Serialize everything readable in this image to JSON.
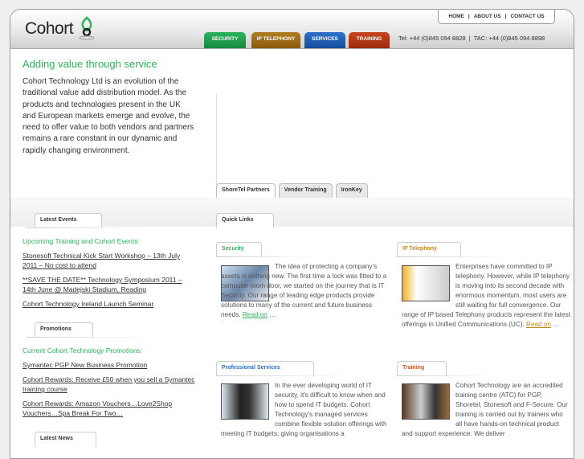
{
  "header": {
    "logo": "Cohort",
    "topnav": [
      "HOME",
      "ABOUT US",
      "CONTACT US"
    ],
    "tabs": [
      {
        "label": "SECURITY",
        "color": "#1e9b4c"
      },
      {
        "label": "IP TELEPHONY",
        "color": "#9b6a12"
      },
      {
        "label": "SERVICES",
        "color": "#1a5cb3"
      },
      {
        "label": "TRAINING",
        "color": "#b0341a"
      }
    ],
    "phone": "Tel: +44 (0)845 094 8828  |  TAC: +44 (0)845 094 8898"
  },
  "intro": {
    "heading": "Adding value through service",
    "body": "Cohort Technology Ltd is an evolution of the traditional value add distribution model. As the products and technologies present in the UK and European markets emerge and evolve, the need to offer value to both vendors and partners remains a rare constant in our dynamic and rapidly changing environment."
  },
  "feature_tabs": [
    "ShoreTel Partners",
    "Vendor Training",
    "IronKey"
  ],
  "events": {
    "tab": "Latest Events",
    "subheading": "Upcoming Training and Cohort Events:",
    "links": [
      "Stonesoft Technical Kick Start Workshop – 13th July 2011 – No cost to attend",
      "**SAVE THE DATE** Technology Symposium 2011 – 14th June @ Madejski Stadium, Reading",
      "Cohort Technology Ireland Launch Seminar"
    ]
  },
  "promotions": {
    "tab": "Promotions",
    "subheading": "Current Cohort Technology Promotions:",
    "links": [
      "Symantec PGP New Business Promotion",
      "Cohort Rewards: Receive £50 when you sell a Symantec training course",
      "Cohort Rewards: Amazon Vouchers…Love2Shop Vouchers…Spa Break For Two…"
    ]
  },
  "news": {
    "tab": "Latest News"
  },
  "quick_links": {
    "tab": "Quick Links",
    "items": [
      {
        "title": "Security",
        "color": "#2db45a",
        "text": "The idea of protecting a company's assets is nothing new. The first time a lock was fitted to a computer room door, we started on the journey that is IT Security. Our range of leading edge products provide solutions to many of the current and future business needs.",
        "read": "Read on",
        "ellipsis": " …"
      },
      {
        "title": "IP Telephony",
        "color": "#c08a20",
        "text": "Enterprises have committed to IP telephony. However, while IP telephony is moving into its second decade with enormous momentum, most users are still waiting for full convergence. Our range of IP based Telephony products represent the latest offerings in Unified Communications (UC).",
        "read": "Read on",
        "ellipsis": " …"
      },
      {
        "title": "Professional Services",
        "color": "#2a6fc0",
        "text": "In the ever developing world of IT security, it's difficult to know when and how to spend IT budgets. Cohort Technology's managed services combine flexible solution offerings with meeting IT budgets; giving organisations a"
      },
      {
        "title": "Training",
        "color": "#c0582a",
        "text": "Cohort Technology are an accredited training centre (ATC) for PGP, Shoretel, Stonesoft and F-Secure. Our training is carried out by trainers who all have hands-on technical product and support experience. We deliver"
      }
    ]
  }
}
